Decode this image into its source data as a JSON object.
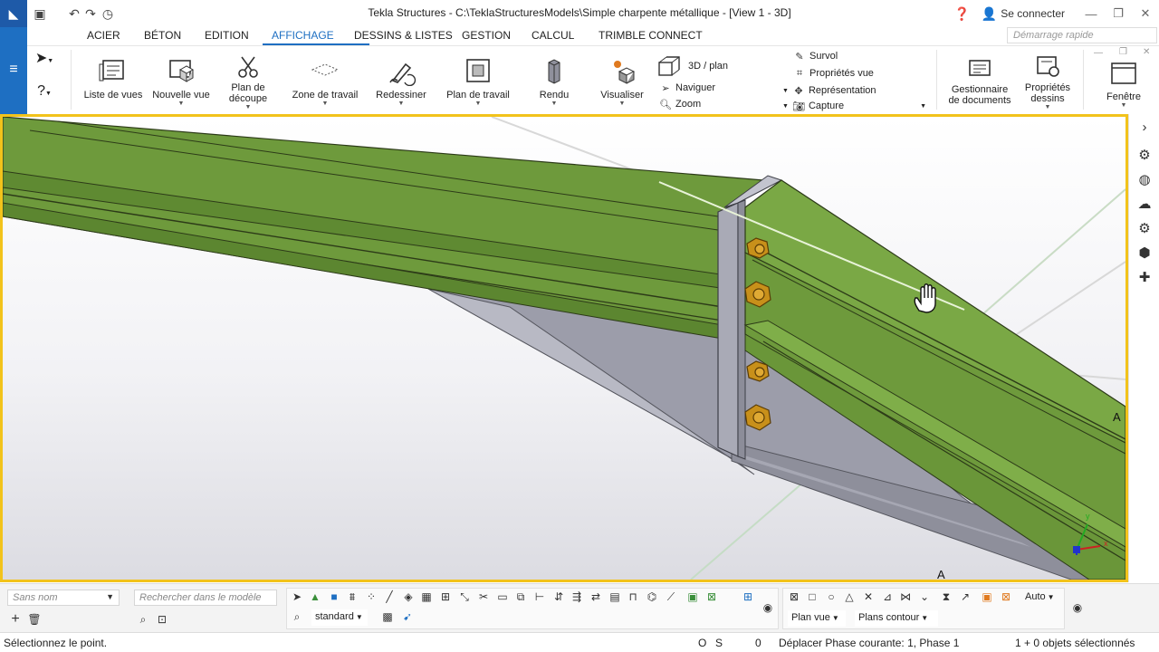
{
  "app": {
    "title": "Tekla Structures - C:\\TeklaStructuresModels\\Simple charpente métallique - [View 1 - 3D]",
    "signin_label": "Se connecter",
    "quick_search_placeholder": "Démarrage rapide"
  },
  "tabs": [
    {
      "label": "ACIER"
    },
    {
      "label": "BÉTON"
    },
    {
      "label": "EDITION"
    },
    {
      "label": "AFFICHAGE",
      "active": true
    },
    {
      "label": "DESSINS & LISTES"
    },
    {
      "label": "GESTION"
    },
    {
      "label": "CALCUL"
    },
    {
      "label": "TRIMBLE CONNECT"
    }
  ],
  "ribbon": {
    "liste_vues": "Liste de vues",
    "nouvelle_vue": "Nouvelle vue",
    "plan_decoupe_1": "Plan de",
    "plan_decoupe_2": "découpe",
    "zone_travail": "Zone de travail",
    "redessiner": "Redessiner",
    "plan_travail": "Plan de travail",
    "rendu": "Rendu",
    "visualiser": "Visualiser",
    "vue_3d_plan": "3D / plan",
    "naviguer": "Naviguer",
    "zoom": "Zoom",
    "survol": "Survol",
    "proprietes_vue": "Propriétés vue",
    "representation": "Représentation",
    "capture": "Capture",
    "gestionnaire_1": "Gestionnaire",
    "gestionnaire_2": "de documents",
    "proprietes_dessins_1": "Propriétés",
    "proprietes_dessins_2": "dessins",
    "fenetre": "Fenêtre"
  },
  "viewport": {
    "grid_label_right": "A",
    "grid_label_bottom": "A",
    "axis_x": "x",
    "axis_y": "y",
    "colors": {
      "beam": "#6e9a3c",
      "beam_top": "#7aa845",
      "plate": "#a7a8b4",
      "bolt": "#c8901a",
      "frame": "#f2c31b"
    }
  },
  "bottom": {
    "name_combo": "Sans nom",
    "search_model_placeholder": "Rechercher dans le modèle",
    "filter_select": "standard",
    "auto_select": "Auto",
    "plan_vue_select": "Plan vue",
    "plans_contour_select": "Plans contour"
  },
  "status": {
    "prompt": "Sélectionnez le point.",
    "o_label": "O",
    "s_label": "S",
    "count": "0",
    "phase": "Déplacer Phase courante: 1, Phase 1",
    "selection": "1 + 0 objets sélectionnés"
  }
}
